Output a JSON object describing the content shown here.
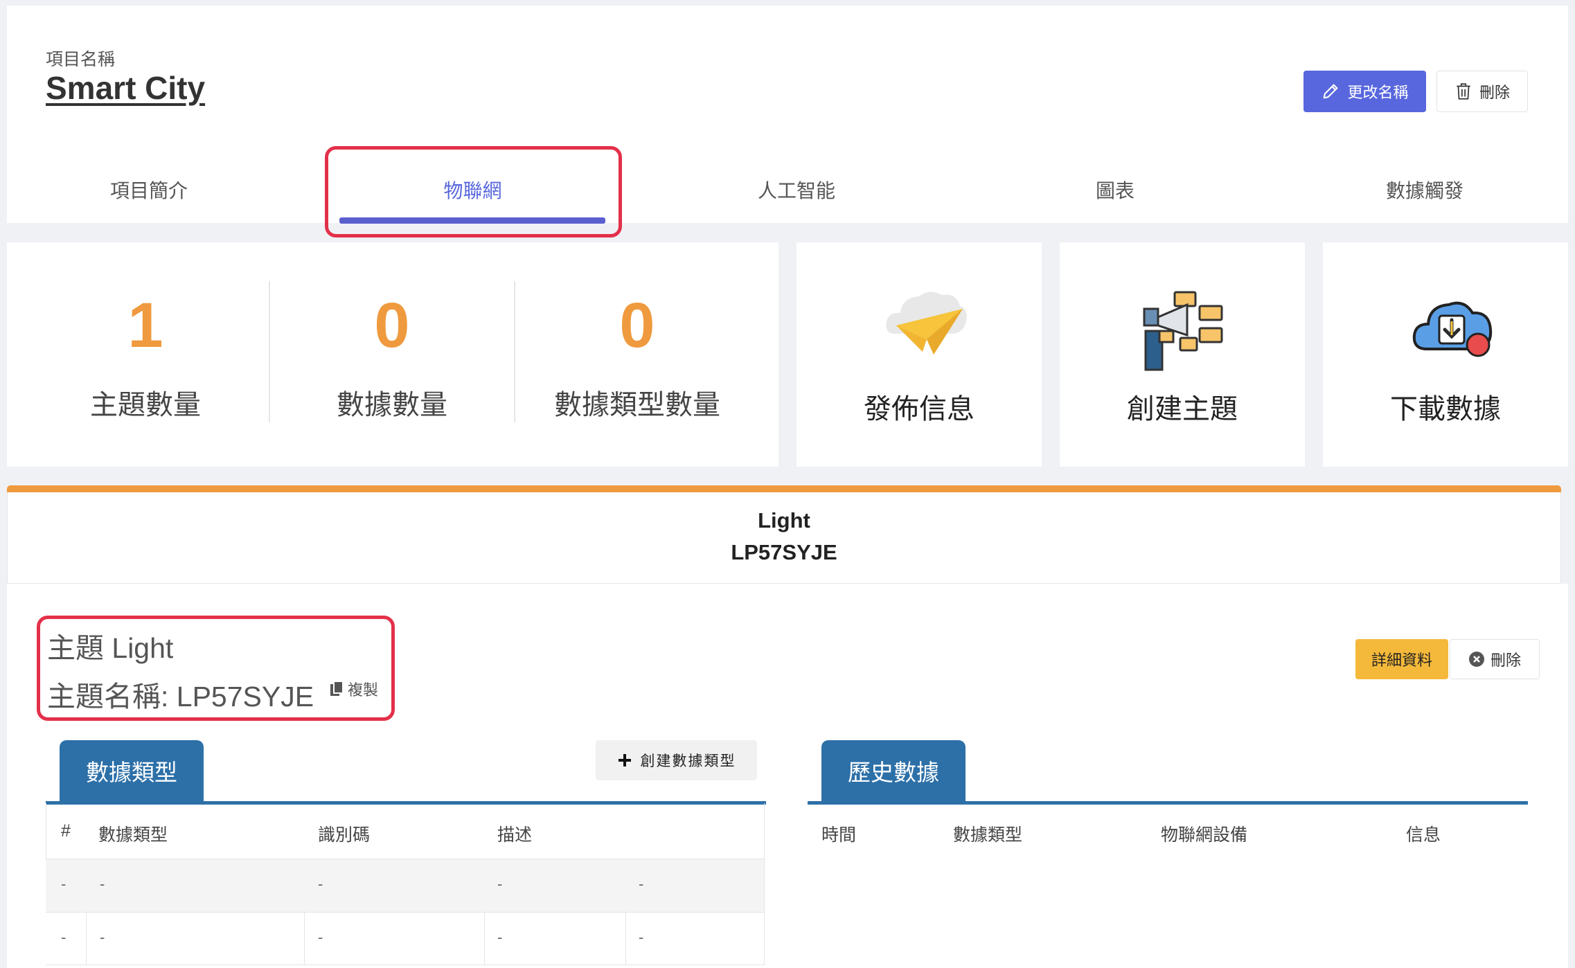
{
  "project": {
    "label": "項目名稱",
    "name": "Smart City",
    "rename_button": "更改名稱",
    "delete_button": "刪除"
  },
  "tabs": [
    {
      "label": "項目簡介",
      "active": false
    },
    {
      "label": "物聯網",
      "active": true
    },
    {
      "label": "人工智能",
      "active": false
    },
    {
      "label": "圖表",
      "active": false
    },
    {
      "label": "數據觸發",
      "active": false
    }
  ],
  "stats": [
    {
      "value": "1",
      "label": "主題數量"
    },
    {
      "value": "0",
      "label": "數據數量"
    },
    {
      "value": "0",
      "label": "數據類型數量"
    }
  ],
  "actions": [
    {
      "label": "發佈信息",
      "icon": "paper-plane-cloud-icon"
    },
    {
      "label": "創建主題",
      "icon": "megaphone-chat-icon"
    },
    {
      "label": "下載數據",
      "icon": "cloud-download-icon"
    }
  ],
  "topic": {
    "header_title": "Light",
    "header_code": "LP57SYJE",
    "line1": "主題 Light",
    "line2": "主題名稱: LP57SYJE",
    "copy_label": "複製",
    "detail_button": "詳細資料",
    "delete_button": "刪除"
  },
  "data_types": {
    "tab_label": "數據類型",
    "create_button": "創建數據類型",
    "columns": [
      "#",
      "數據類型",
      "識別碼",
      "描述"
    ],
    "rows": [
      [
        "-",
        "-",
        "-",
        "-",
        "-"
      ],
      [
        "-",
        "-",
        "-",
        "-",
        "-"
      ]
    ]
  },
  "history": {
    "tab_label": "歷史數據",
    "columns": [
      "時間",
      "數據類型",
      "物聯網設備",
      "信息"
    ]
  },
  "colors": {
    "accent": "#5867dd",
    "orange": "#ef9a3e",
    "highlight": "#e3304a",
    "subtab": "#2d70a8",
    "detail_button": "#f4b93a"
  }
}
